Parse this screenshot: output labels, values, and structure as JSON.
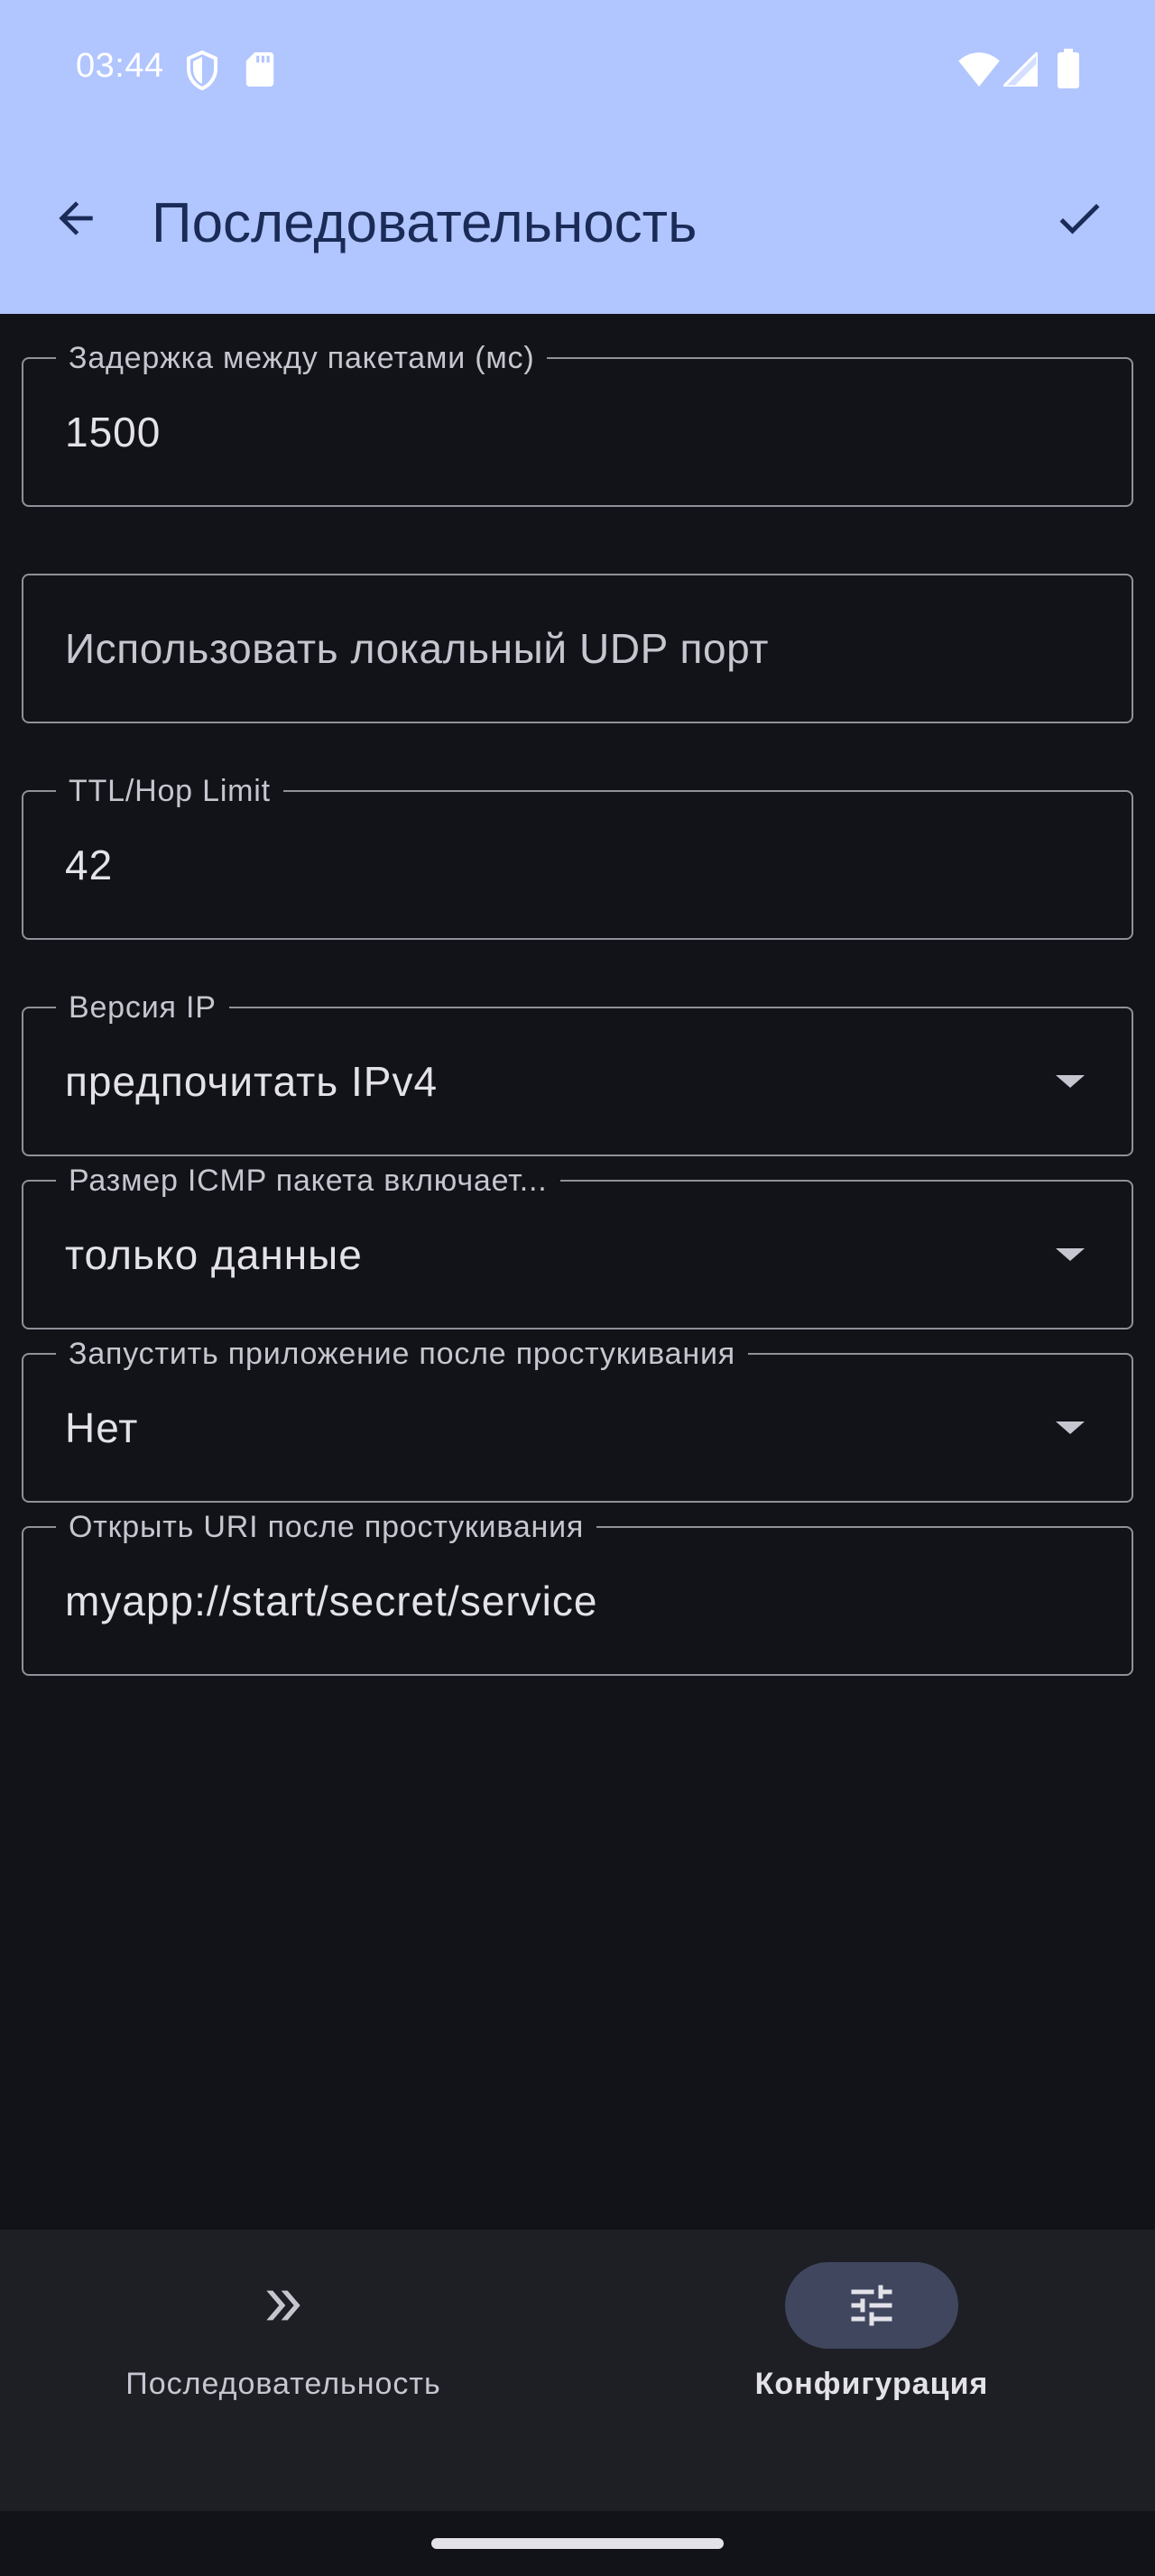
{
  "status_bar": {
    "time": "03:44"
  },
  "app_bar": {
    "title": "Последовательность",
    "back_icon": "arrow-back-icon",
    "confirm_icon": "check-icon"
  },
  "fields": {
    "delay": {
      "label": "Задержка между пакетами (мс)",
      "value": "1500"
    },
    "local_udp": {
      "placeholder": "Использовать локальный UDP порт"
    },
    "ttl": {
      "label": "TTL/Hop Limit",
      "value": "42"
    },
    "ip_version": {
      "label": "Версия IP",
      "value": "предпочитать IPv4"
    },
    "icmp_size": {
      "label": "Размер ICMP пакета включает...",
      "value": "только данные"
    },
    "launch_app": {
      "label": "Запустить приложение после простукивания",
      "value": "Нет"
    },
    "open_uri": {
      "label": "Открыть URI после простукивания",
      "value": "myapp://start/secret/service"
    }
  },
  "bottom_nav": {
    "items": [
      {
        "label": "Последовательность",
        "icon": "double-chevron-right-icon",
        "active": false
      },
      {
        "label": "Конфигурация",
        "icon": "tune-icon",
        "active": true
      }
    ]
  },
  "colors": {
    "top_bar": "#b1c5ff",
    "background": "#121318",
    "bottom_nav": "#1e1f25",
    "active_indicator": "#3f465e",
    "outline": "#8f9099"
  }
}
